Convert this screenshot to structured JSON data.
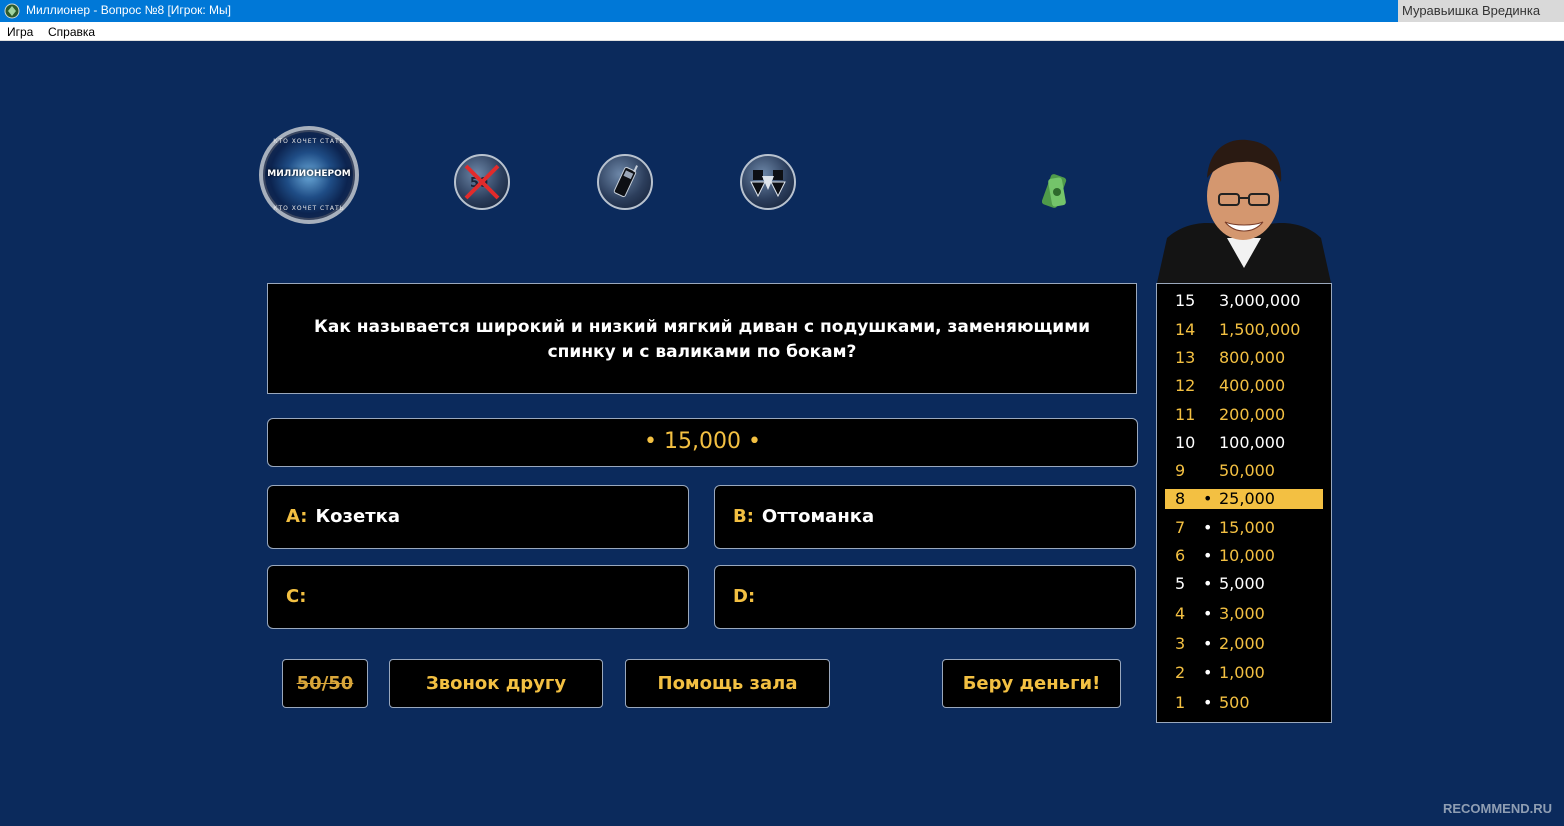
{
  "window": {
    "title": "Миллионер - Вопрос №8 [Игрок: Мы]",
    "user_tag": "Муравьишка Врединка"
  },
  "menu": [
    "Игра",
    "Справка"
  ],
  "logo": {
    "ring_text": "КТО ХОЧЕТ СТАТЬ",
    "main_text": "МИЛЛИОНЕРОМ"
  },
  "lifeline_icons": [
    {
      "name": "fifty-fifty",
      "used": true
    },
    {
      "name": "phone-a-friend",
      "used": false
    },
    {
      "name": "ask-the-audience",
      "used": false
    }
  ],
  "question": {
    "text": "Как называется широкий и низкий мягкий диван с подушками, заменяющими спинку и с валиками по бокам?",
    "prize": "• 15,000 •"
  },
  "answers": [
    {
      "letter": "A:",
      "text": "Козетка"
    },
    {
      "letter": "B:",
      "text": "Оттоманка"
    },
    {
      "letter": "C:",
      "text": ""
    },
    {
      "letter": "D:",
      "text": ""
    }
  ],
  "buttons": {
    "fifty": "50/50",
    "phone": "Звонок другу",
    "audience": "Помощь зала",
    "take_money": "Беру деньги!"
  },
  "money_tree": [
    {
      "num": "15",
      "amount": "3,000,000",
      "dot": ""
    },
    {
      "num": "14",
      "amount": "1,500,000",
      "dot": ""
    },
    {
      "num": "13",
      "amount": "800,000",
      "dot": ""
    },
    {
      "num": "12",
      "amount": "400,000",
      "dot": ""
    },
    {
      "num": "11",
      "amount": "200,000",
      "dot": ""
    },
    {
      "num": "10",
      "amount": "100,000",
      "dot": ""
    },
    {
      "num": "9",
      "amount": "50,000",
      "dot": ""
    },
    {
      "num": "8",
      "amount": "25,000",
      "dot": "•",
      "current": true
    },
    {
      "num": "7",
      "amount": "15,000",
      "dot": "•"
    },
    {
      "num": "6",
      "amount": "10,000",
      "dot": "•"
    },
    {
      "num": "5",
      "amount": "5,000",
      "dot": "•"
    },
    {
      "num": "4",
      "amount": "3,000",
      "dot": "•"
    },
    {
      "num": "3",
      "amount": "2,000",
      "dot": "•"
    },
    {
      "num": "2",
      "amount": "1,000",
      "dot": "•"
    },
    {
      "num": "1",
      "amount": "500",
      "dot": "•"
    }
  ],
  "watermark": "RECOMMEND.RU",
  "colors": {
    "accent": "#f3c042",
    "background": "#0b2a5c"
  }
}
